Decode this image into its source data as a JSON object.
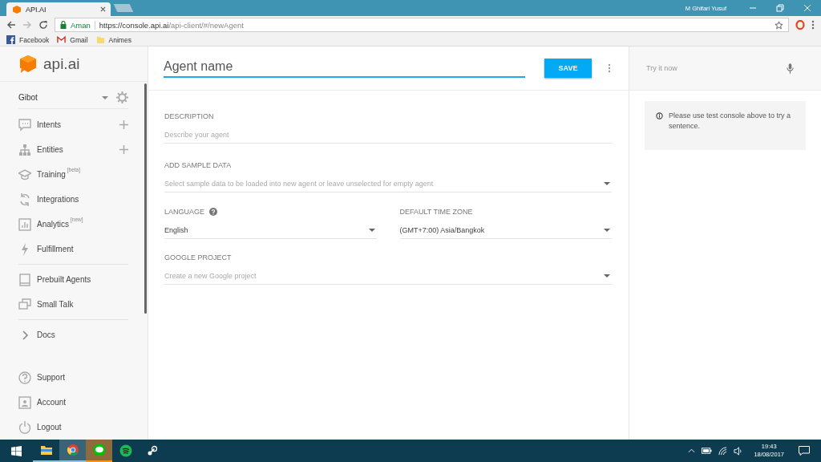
{
  "browser": {
    "tab": {
      "title": "API.AI"
    },
    "profile": "M Ghifari Yusuf",
    "site_name": "Aman",
    "url_host": "https://console.api.ai",
    "url_path": "/api-client/#/newAgent",
    "bookmarks": [
      {
        "kind": "facebook",
        "label": "Facebook"
      },
      {
        "kind": "gmail",
        "label": "Gmail"
      },
      {
        "kind": "folder",
        "label": "Animes"
      }
    ]
  },
  "sidebar": {
    "logo": "api.ai",
    "agent": "Gibot",
    "groups": [
      [
        {
          "kind": "intents",
          "label": "Intents",
          "add": true
        },
        {
          "kind": "entities",
          "label": "Entities",
          "add": true
        },
        {
          "kind": "training",
          "label": "Training",
          "badge": "[beta]",
          "add": false
        },
        {
          "kind": "integrations",
          "label": "Integrations",
          "add": false
        },
        {
          "kind": "analytics",
          "label": "Analytics",
          "badge": "[new]",
          "add": false
        },
        {
          "kind": "fulfillment",
          "label": "Fulfillment",
          "add": false
        }
      ],
      [
        {
          "kind": "prebuilt",
          "label": "Prebuilt Agents",
          "add": false
        },
        {
          "kind": "smalltalk",
          "label": "Small Talk",
          "add": false
        }
      ],
      [
        {
          "kind": "docs",
          "label": "Docs",
          "add": false
        }
      ],
      [
        {
          "kind": "support",
          "label": "Support",
          "add": false
        },
        {
          "kind": "account",
          "label": "Account",
          "add": false
        },
        {
          "kind": "logout",
          "label": "Logout",
          "add": false
        }
      ]
    ]
  },
  "main": {
    "agent_name": {
      "placeholder": "Agent name"
    },
    "save_button": "SAVE",
    "fields": [
      {
        "kind": "text",
        "label": "DESCRIPTION",
        "placeholder": "Describe your agent"
      },
      {
        "kind": "select",
        "label": "ADD SAMPLE DATA",
        "placeholder": "Select sample data to be loaded into new agent or leave unselected for empty agent"
      },
      {
        "kind": "pair",
        "items": [
          {
            "label": "LANGUAGE",
            "value": "English",
            "help": true
          },
          {
            "label": "DEFAULT TIME ZONE",
            "value": "(GMT+7:00) Asia/Bangkok"
          }
        ]
      },
      {
        "kind": "select",
        "label": "GOOGLE PROJECT",
        "placeholder": "Create a new Google project"
      }
    ]
  },
  "test_panel": {
    "placeholder": "Try it now",
    "notice": "Please use test console above to try a sentence."
  },
  "taskbar": {
    "apps": [
      {
        "kind": "explorer",
        "open": true,
        "selected": false,
        "attention": false
      },
      {
        "kind": "chrome",
        "open": true,
        "selected": true,
        "attention": false
      },
      {
        "kind": "line",
        "open": true,
        "selected": false,
        "attention": true
      },
      {
        "kind": "spotify",
        "open": false,
        "selected": false,
        "attention": false
      },
      {
        "kind": "steam",
        "open": false,
        "selected": false,
        "attention": false
      }
    ],
    "time": "19:43",
    "date": "18/08/2017"
  }
}
